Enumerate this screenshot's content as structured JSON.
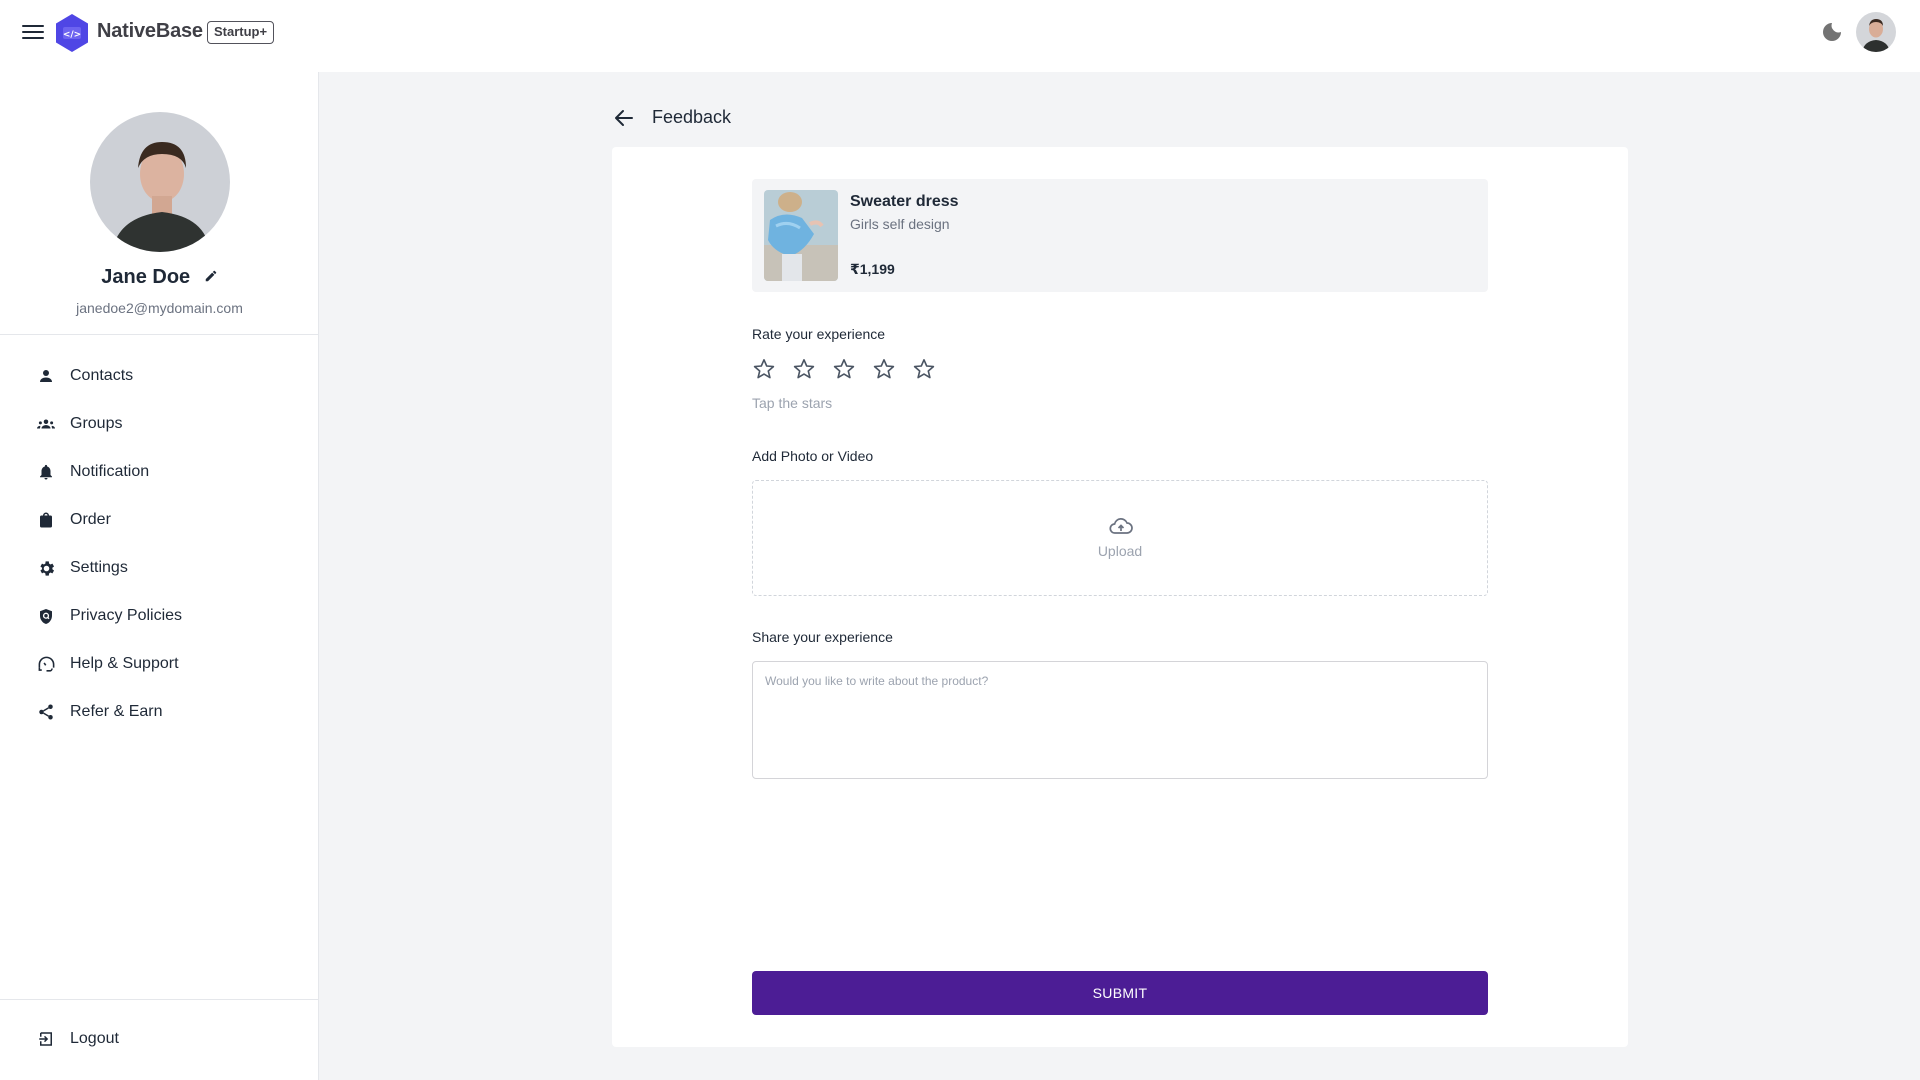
{
  "header": {
    "brand": "NativeBase",
    "badge": "Startup+",
    "logo_glyph": "</>",
    "icons": {
      "menu": "hamburger-icon",
      "theme": "moon-icon",
      "avatar": "user-avatar"
    }
  },
  "profile": {
    "name": "Jane Doe",
    "email": "janedoe2@mydomain.com"
  },
  "sidebar": {
    "items": [
      {
        "label": "Contacts",
        "icon": "person-icon"
      },
      {
        "label": "Groups",
        "icon": "groups-icon"
      },
      {
        "label": "Notification",
        "icon": "bell-icon"
      },
      {
        "label": "Order",
        "icon": "shopping-bag-icon"
      },
      {
        "label": "Settings",
        "icon": "gear-icon"
      },
      {
        "label": "Privacy Policies",
        "icon": "shield-icon"
      },
      {
        "label": "Help & Support",
        "icon": "support-icon"
      },
      {
        "label": "Refer & Earn",
        "icon": "share-icon"
      }
    ],
    "logout": {
      "label": "Logout",
      "icon": "logout-icon"
    }
  },
  "page": {
    "title": "Feedback"
  },
  "product": {
    "name": "Sweater dress",
    "description": "Girls self design",
    "price": "₹1,199"
  },
  "rating": {
    "label": "Rate your experience",
    "value": 0,
    "max": 5,
    "hint": "Tap the stars"
  },
  "media": {
    "label": "Add Photo or Video",
    "upload_label": "Upload"
  },
  "review": {
    "label": "Share your experience",
    "value": "",
    "placeholder": "Would you like to write about the product?"
  },
  "submit_label": "SUBMIT",
  "colors": {
    "primary": "#4c1d95",
    "brand": "#4f46e5",
    "background": "#f3f4f6"
  }
}
